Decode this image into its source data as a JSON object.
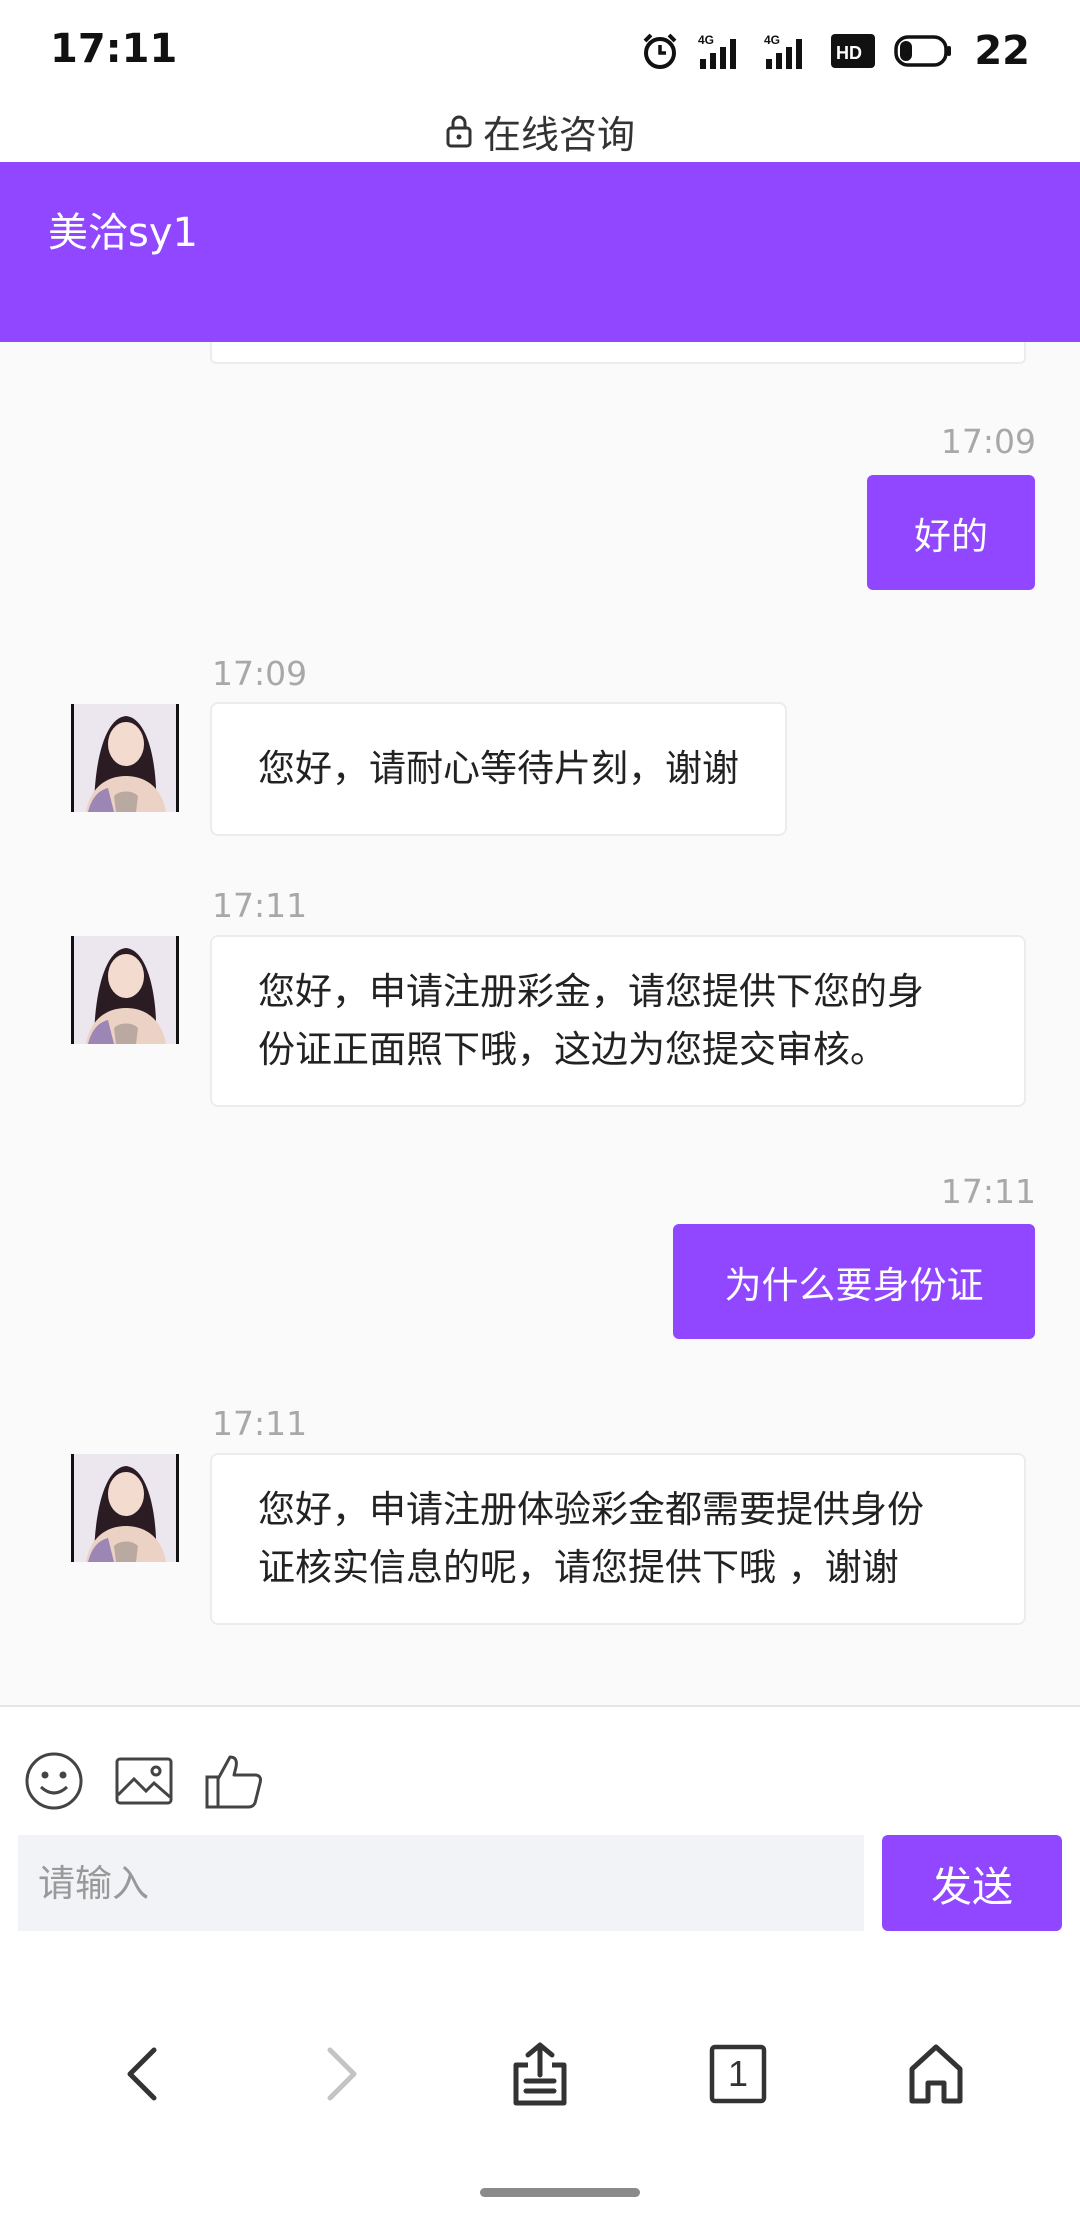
{
  "status_bar": {
    "time": "17:11",
    "battery": "22",
    "icons": [
      "alarm-icon",
      "4g-signal-icon",
      "4g-signal-icon",
      "hd-icon",
      "battery-icon"
    ]
  },
  "browser": {
    "page_title": "在线咨询",
    "lock_icon": "lock-icon"
  },
  "header": {
    "title": "美洽sy1",
    "color": "#9147ff"
  },
  "messages": [
    {
      "side": "out",
      "time": "17:09",
      "text": "好的"
    },
    {
      "side": "in",
      "time": "17:09",
      "text": "您好，请耐心等待片刻，谢谢"
    },
    {
      "side": "in",
      "time": "17:11",
      "lines": [
        "您好，申请注册彩金，请您提供下您的身",
        "份证正面照下哦，这边为您提交审核。"
      ]
    },
    {
      "side": "out",
      "time": "17:11",
      "text": "为什么要身份证"
    },
    {
      "side": "in",
      "time": "17:11",
      "lines": [
        "您好，申请注册体验彩金都需要提供身份",
        "证核实信息的呢，请您提供下哦 ，谢谢"
      ]
    }
  ],
  "composer": {
    "placeholder": "请输入",
    "send_label": "发送",
    "tools": [
      "emoji-icon",
      "image-icon",
      "thumbs-up-icon"
    ]
  },
  "nav": {
    "tab_count": "1",
    "icons": [
      "back-icon",
      "forward-icon",
      "share-icon",
      "tabs-icon",
      "home-icon"
    ]
  }
}
